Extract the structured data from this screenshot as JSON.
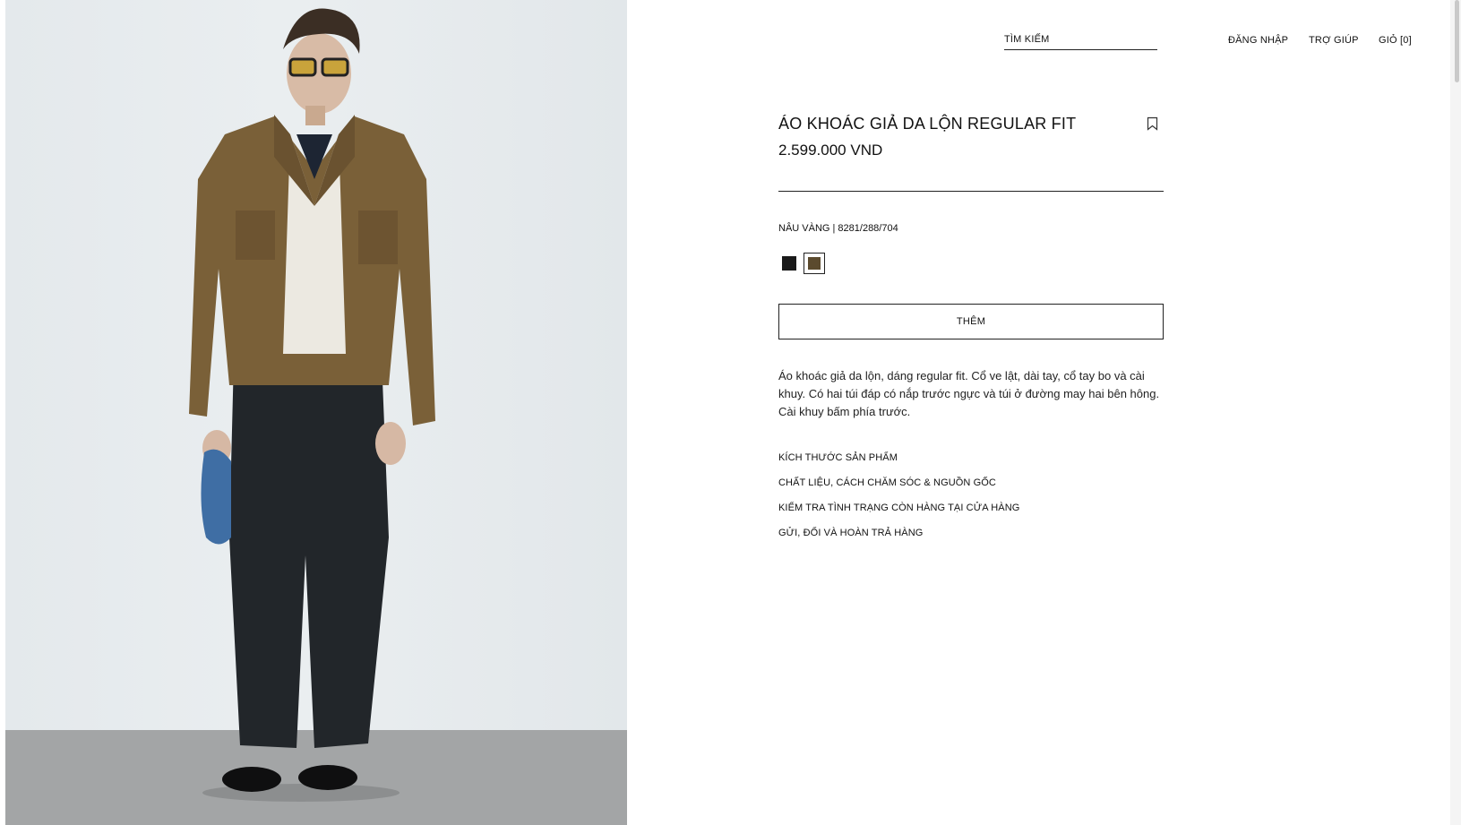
{
  "header": {
    "search_label": "TÌM KIẾM",
    "login_label": "ĐĂNG NHẬP",
    "help_label": "TRỢ GIÚP",
    "cart_label": "GIỎ [0]"
  },
  "product": {
    "title": "ÁO KHOÁC GIẢ DA LỘN REGULAR FIT",
    "price": "2.599.000 VND",
    "color_ref": "NÂU VÀNG | 8281/288/704",
    "colors": [
      {
        "name": "black",
        "hex": "#1a1a1a",
        "selected": false
      },
      {
        "name": "brown",
        "hex": "#5b4a2e",
        "selected": true
      }
    ],
    "add_label": "THÊM",
    "description": "Áo khoác giả da lộn, dáng regular fit. Cổ ve lật, dài tay, cổ tay bo và cài khuy. Có hai túi đáp có nắp trước ngực và túi ở đường may hai bên hông. Cài khuy bấm phía trước.",
    "links": [
      "KÍCH THƯỚC SẢN PHẨM",
      "CHẤT LIỆU, CÁCH CHĂM SÓC & NGUỒN GỐC",
      "KIỂM TRA TÌNH TRẠNG CÒN HÀNG TẠI CỬA HÀNG",
      "GỬI, ĐỔI VÀ HOÀN TRẢ HÀNG"
    ]
  },
  "icons": {
    "bookmark": "bookmark-icon"
  }
}
